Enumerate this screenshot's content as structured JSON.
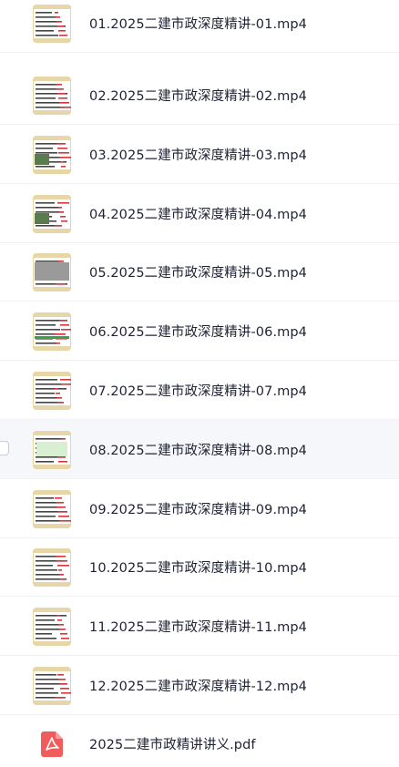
{
  "files": [
    {
      "name": "01.2025二建市政深度精讲-01.mp4",
      "type": "video",
      "thumb_icon": "video-thumbnail-icon"
    },
    {
      "name": "02.2025二建市政深度精讲-02.mp4",
      "type": "video",
      "thumb_icon": "video-thumbnail-icon"
    },
    {
      "name": "03.2025二建市政深度精讲-03.mp4",
      "type": "video",
      "thumb_icon": "video-thumbnail-icon"
    },
    {
      "name": "04.2025二建市政深度精讲-04.mp4",
      "type": "video",
      "thumb_icon": "video-thumbnail-icon"
    },
    {
      "name": "05.2025二建市政深度精讲-05.mp4",
      "type": "video",
      "thumb_icon": "video-thumbnail-icon"
    },
    {
      "name": "06.2025二建市政深度精讲-06.mp4",
      "type": "video",
      "thumb_icon": "video-thumbnail-icon"
    },
    {
      "name": "07.2025二建市政深度精讲-07.mp4",
      "type": "video",
      "thumb_icon": "video-thumbnail-icon"
    },
    {
      "name": "08.2025二建市政深度精讲-08.mp4",
      "type": "video",
      "thumb_icon": "video-thumbnail-icon",
      "selected": true
    },
    {
      "name": "09.2025二建市政深度精讲-09.mp4",
      "type": "video",
      "thumb_icon": "video-thumbnail-icon"
    },
    {
      "name": "10.2025二建市政深度精讲-10.mp4",
      "type": "video",
      "thumb_icon": "video-thumbnail-icon"
    },
    {
      "name": "11.2025二建市政深度精讲-11.mp4",
      "type": "video",
      "thumb_icon": "video-thumbnail-icon"
    },
    {
      "name": "12.2025二建市政深度精讲-12.mp4",
      "type": "video",
      "thumb_icon": "video-thumbnail-icon"
    },
    {
      "name": "2025二建市政精讲讲义.pdf",
      "type": "pdf",
      "thumb_icon": "pdf-file-icon"
    }
  ],
  "colors": {
    "text": "#1f2233",
    "row_selected_bg": "#f6f7fb",
    "divider": "#f1f2f5",
    "thumb_frame": "#e6d6a8",
    "slide_red": "#d8343a",
    "pdf_red": "#f25b5b"
  }
}
